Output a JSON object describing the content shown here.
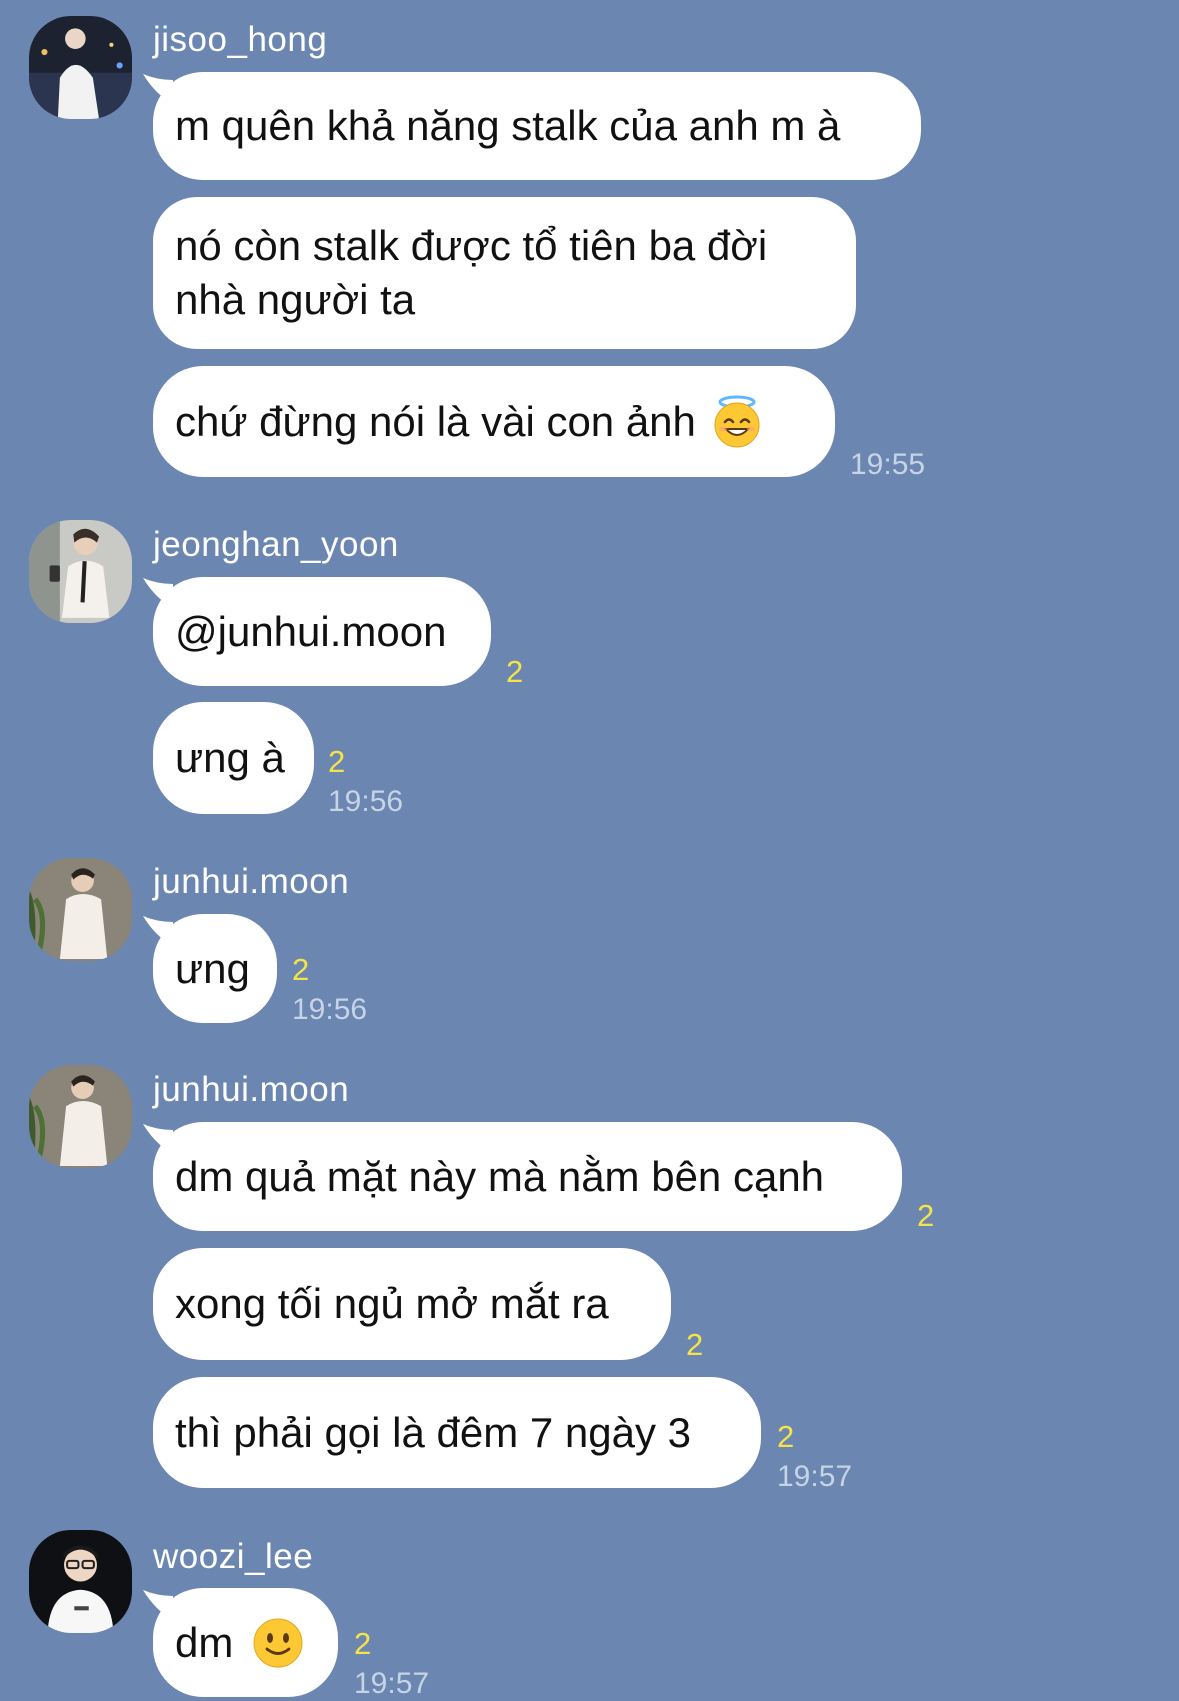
{
  "groups": [
    {
      "sender": "jisoo_hong",
      "messages": [
        {
          "text": "m quên khả năng stalk của anh m à"
        },
        {
          "text": "nó còn stalk được tổ tiên ba đời nhà người ta"
        },
        {
          "text": "chứ đừng nói là vài con ảnh",
          "emoji": "smiling-face-with-halo-icon"
        }
      ],
      "time": "19:55"
    },
    {
      "sender": "jeonghan_yoon",
      "messages": [
        {
          "text": "@junhui.moon",
          "read_count": "2"
        },
        {
          "text": "ưng à",
          "read_count": "2"
        }
      ],
      "time": "19:56"
    },
    {
      "sender": "junhui.moon",
      "messages": [
        {
          "text": "ưng",
          "read_count": "2"
        }
      ],
      "time": "19:56"
    },
    {
      "sender": "junhui.moon",
      "messages": [
        {
          "text": "dm quả mặt này mà nằm bên cạnh",
          "read_count": "2"
        },
        {
          "text": "xong tối ngủ mở mắt ra",
          "read_count": "2"
        },
        {
          "text": "thì phải gọi là đêm 7 ngày 3",
          "read_count": "2"
        }
      ],
      "time": "19:57"
    },
    {
      "sender": "woozi_lee",
      "messages": [
        {
          "text": "dm",
          "emoji": "slightly-smiling-face-icon",
          "read_count": "2"
        }
      ],
      "time": "19:57"
    }
  ],
  "colors": {
    "background": "#6b86b0",
    "bubble": "#ffffff",
    "read_count": "#f4e44a",
    "timestamp": "#c7d3e6",
    "sender_name": "#ffffff"
  }
}
